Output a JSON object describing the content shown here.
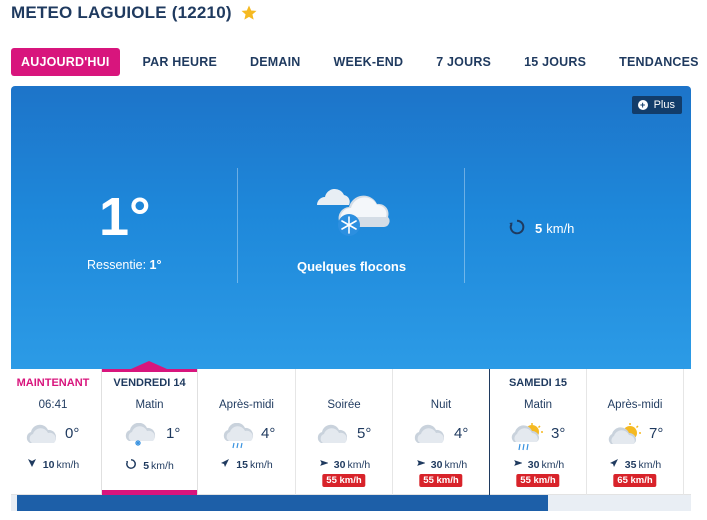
{
  "header": {
    "title": "METEO LAGUIOLE (12210)",
    "favorite_icon": "star-icon",
    "star_color": "#f5b921"
  },
  "tabs": [
    {
      "label": "AUJOURD'HUI",
      "active": true
    },
    {
      "label": "PAR HEURE"
    },
    {
      "label": "DEMAIN"
    },
    {
      "label": "WEEK-END"
    },
    {
      "label": "7 JOURS"
    },
    {
      "label": "15 JOURS"
    },
    {
      "label": "TENDANCES"
    }
  ],
  "current": {
    "plus_label": "Plus",
    "temperature": "1°",
    "ressentie_label": "Ressentie:",
    "ressentie_value": "1°",
    "condition": "Quelques flocons",
    "condition_icon": "cloud-snow-icon",
    "wind_speed": "5",
    "wind_unit": "km/h",
    "wind_icon": "variable-wind-icon"
  },
  "forecast": [
    {
      "head": "MAINTENANT",
      "sub": "06:41",
      "icon": "cloud-icon",
      "temp": "0°",
      "wind_icon": "arrow-down-icon",
      "wind": "10",
      "unit": "km/h",
      "gust": ""
    },
    {
      "head": "VENDREDI 14",
      "sub": "Matin",
      "icon": "cloud-snow-icon",
      "temp": "1°",
      "wind_icon": "variable-wind-icon",
      "wind": "5",
      "unit": "km/h",
      "gust": ""
    },
    {
      "head": "",
      "sub": "Après-midi",
      "icon": "cloud-rain-icon",
      "temp": "4°",
      "wind_icon": "arrow-ne-icon",
      "wind": "15",
      "unit": "km/h",
      "gust": ""
    },
    {
      "head": "",
      "sub": "Soirée",
      "icon": "cloud-icon",
      "temp": "5°",
      "wind_icon": "arrow-ne-icon",
      "wind": "30",
      "unit": "km/h",
      "gust": "55 km/h"
    },
    {
      "head": "",
      "sub": "Nuit",
      "icon": "cloud-icon",
      "temp": "4°",
      "wind_icon": "arrow-ne-icon",
      "wind": "30",
      "unit": "km/h",
      "gust": "55 km/h"
    },
    {
      "head": "SAMEDI 15",
      "sub": "Matin",
      "icon": "sun-cloud-rain-icon",
      "temp": "3°",
      "wind_icon": "arrow-ne-icon",
      "wind": "30",
      "unit": "km/h",
      "gust": "55 km/h"
    },
    {
      "head": "",
      "sub": "Après-midi",
      "icon": "sun-cloud-icon",
      "temp": "7°",
      "wind_icon": "arrow-ne-icon",
      "wind": "35",
      "unit": "km/h",
      "gust": "65 km/h"
    }
  ],
  "colors": {
    "accent": "#d8157d",
    "navy": "#1f3a5f",
    "sky": "#1e88da",
    "gust": "#d8232a"
  },
  "scroll": {
    "position": 0.78
  }
}
